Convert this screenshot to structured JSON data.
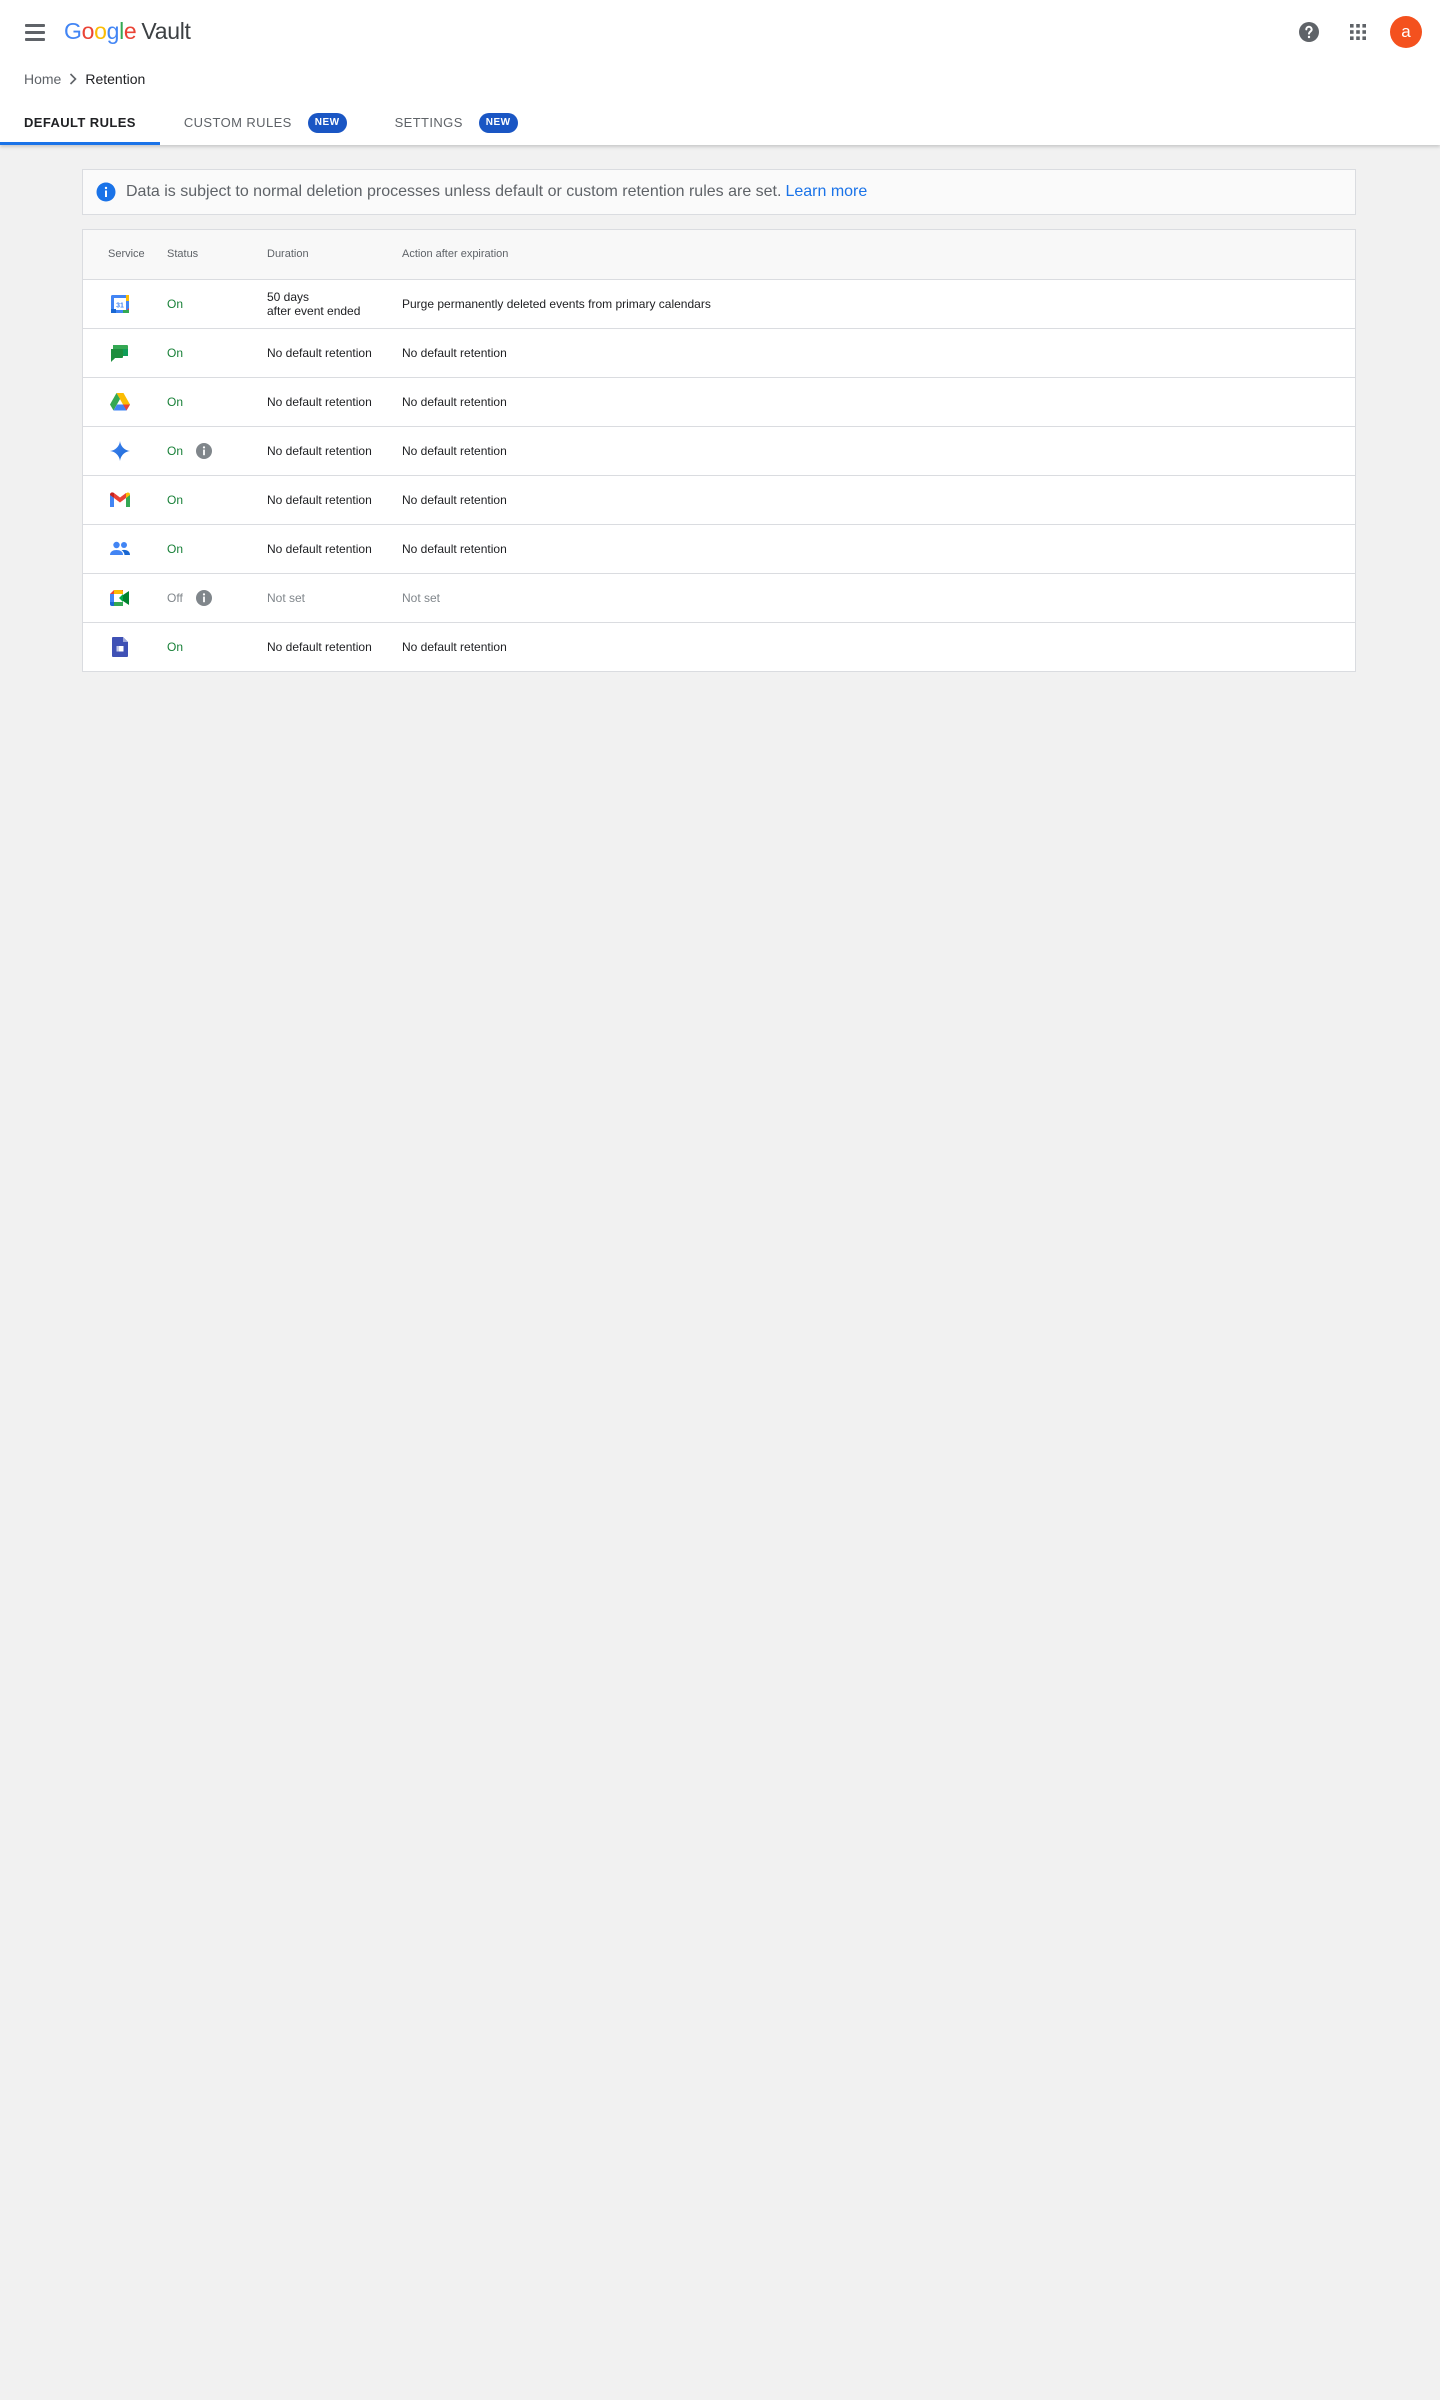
{
  "app": {
    "logo_letters": [
      "G",
      "o",
      "o",
      "g",
      "l",
      "e"
    ],
    "logo_colors": [
      "#4285F4",
      "#EA4335",
      "#FBBC05",
      "#4285F4",
      "#34A853",
      "#EA4335"
    ],
    "product": "Vault",
    "avatar_initial": "a",
    "avatar_color": "#f4511e"
  },
  "header": {
    "icons": [
      "menu-icon",
      "help-icon",
      "apps-grid-icon"
    ]
  },
  "breadcrumb": {
    "home": "Home",
    "current": "Retention"
  },
  "tabs": [
    {
      "label": "DEFAULT RULES",
      "active": true,
      "badge": ""
    },
    {
      "label": "CUSTOM RULES",
      "active": false,
      "badge": "NEW"
    },
    {
      "label": "SETTINGS",
      "active": false,
      "badge": "NEW"
    }
  ],
  "banner": {
    "text": "Data is subject to normal deletion processes unless default or custom retention rules are set.",
    "link": "Learn more"
  },
  "table": {
    "headers": {
      "service": "Service",
      "status": "Status",
      "duration": "Duration",
      "action": "Action after expiration"
    },
    "rows": [
      {
        "icon": "calendar-icon",
        "status": "On",
        "duration": [
          "50 days",
          "after event ended"
        ],
        "action": "Purge permanently deleted events from primary calendars"
      },
      {
        "icon": "chat-icon",
        "status": "On",
        "duration": [
          "No default retention"
        ],
        "action": "No default retention"
      },
      {
        "icon": "drive-icon",
        "status": "On",
        "duration": [
          "No default retention"
        ],
        "action": "No default retention"
      },
      {
        "icon": "gemini-icon",
        "status": "On",
        "status_info": true,
        "duration": [
          "No default retention"
        ],
        "action": "No default retention"
      },
      {
        "icon": "gmail-icon",
        "status": "On",
        "duration": [
          "No default retention"
        ],
        "action": "No default retention"
      },
      {
        "icon": "groups-icon",
        "status": "On",
        "duration": [
          "No default retention"
        ],
        "action": "No default retention"
      },
      {
        "icon": "meet-icon",
        "status": "Off",
        "status_info": true,
        "duration": [
          "Not set"
        ],
        "action": "Not set"
      },
      {
        "icon": "sites-icon",
        "status": "On",
        "duration": [
          "No default retention"
        ],
        "action": "No default retention"
      }
    ]
  }
}
